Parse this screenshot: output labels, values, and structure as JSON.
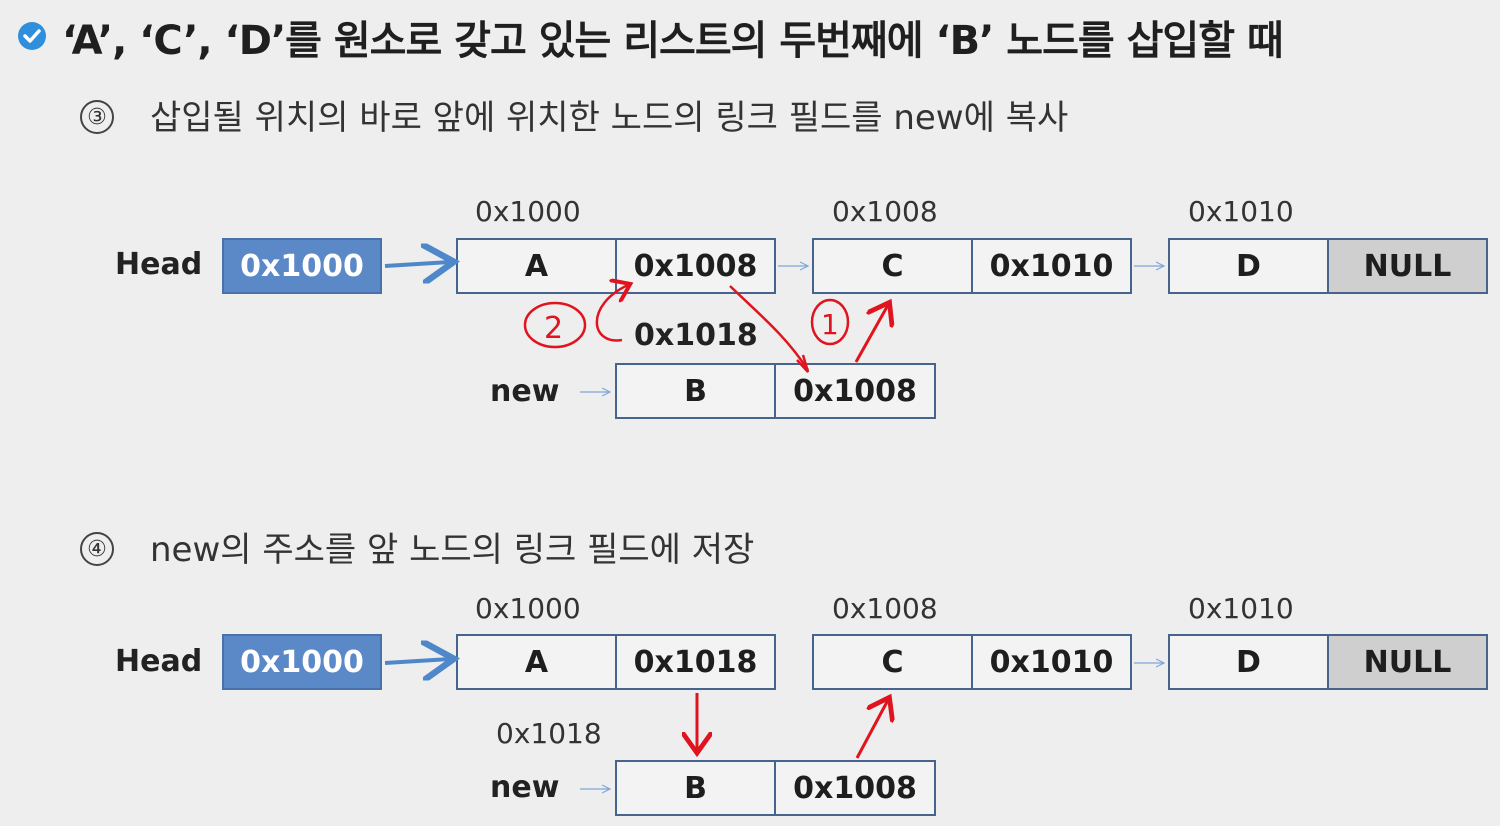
{
  "title": "‘A’, ‘C’, ‘D’를 원소로 갖고 있는 리스트의 두번째에 ‘B’ 노드를 삽입할 때",
  "steps": [
    {
      "number": "③",
      "text": "삽입될 위치의 바로 앞에 위치한 노드의 링크 필드를 new에 복사",
      "head_label": "Head",
      "head_value": "0x1000",
      "nodes": [
        {
          "address": "0x1000",
          "data": "A",
          "link": "0x1008"
        },
        {
          "address": "0x1008",
          "data": "C",
          "link": "0x1010"
        },
        {
          "address": "0x1010",
          "data": "D",
          "link": "NULL"
        }
      ],
      "new_label": "new",
      "new_address": "0x1018",
      "new_node": {
        "data": "B",
        "link": "0x1008"
      },
      "annotations": [
        "2",
        "1"
      ]
    },
    {
      "number": "④",
      "text": "new의 주소를 앞 노드의 링크 필드에 저장",
      "head_label": "Head",
      "head_value": "0x1000",
      "nodes": [
        {
          "address": "0x1000",
          "data": "A",
          "link": "0x1018"
        },
        {
          "address": "0x1008",
          "data": "C",
          "link": "0x1010"
        },
        {
          "address": "0x1010",
          "data": "D",
          "link": "NULL"
        }
      ],
      "new_label": "new",
      "new_address": "0x1018",
      "new_node": {
        "data": "B",
        "link": "0x1008"
      }
    }
  ],
  "colors": {
    "head_fill": "#5b88c6",
    "null_fill": "#cfcfcf",
    "annotation": "#e0141e",
    "arrow_blue": "#4f87cb"
  }
}
